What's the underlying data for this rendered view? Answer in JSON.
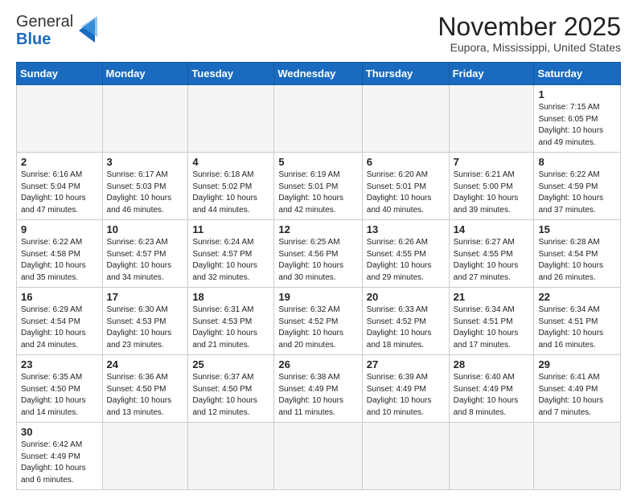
{
  "header": {
    "logo_general": "General",
    "logo_blue": "Blue",
    "month_title": "November 2025",
    "location": "Eupora, Mississippi, United States"
  },
  "days_of_week": [
    "Sunday",
    "Monday",
    "Tuesday",
    "Wednesday",
    "Thursday",
    "Friday",
    "Saturday"
  ],
  "weeks": [
    [
      {
        "day": "",
        "info": ""
      },
      {
        "day": "",
        "info": ""
      },
      {
        "day": "",
        "info": ""
      },
      {
        "day": "",
        "info": ""
      },
      {
        "day": "",
        "info": ""
      },
      {
        "day": "",
        "info": ""
      },
      {
        "day": "1",
        "info": "Sunrise: 7:15 AM\nSunset: 6:05 PM\nDaylight: 10 hours\nand 49 minutes."
      }
    ],
    [
      {
        "day": "2",
        "info": "Sunrise: 6:16 AM\nSunset: 5:04 PM\nDaylight: 10 hours\nand 47 minutes."
      },
      {
        "day": "3",
        "info": "Sunrise: 6:17 AM\nSunset: 5:03 PM\nDaylight: 10 hours\nand 46 minutes."
      },
      {
        "day": "4",
        "info": "Sunrise: 6:18 AM\nSunset: 5:02 PM\nDaylight: 10 hours\nand 44 minutes."
      },
      {
        "day": "5",
        "info": "Sunrise: 6:19 AM\nSunset: 5:01 PM\nDaylight: 10 hours\nand 42 minutes."
      },
      {
        "day": "6",
        "info": "Sunrise: 6:20 AM\nSunset: 5:01 PM\nDaylight: 10 hours\nand 40 minutes."
      },
      {
        "day": "7",
        "info": "Sunrise: 6:21 AM\nSunset: 5:00 PM\nDaylight: 10 hours\nand 39 minutes."
      },
      {
        "day": "8",
        "info": "Sunrise: 6:22 AM\nSunset: 4:59 PM\nDaylight: 10 hours\nand 37 minutes."
      }
    ],
    [
      {
        "day": "9",
        "info": "Sunrise: 6:22 AM\nSunset: 4:58 PM\nDaylight: 10 hours\nand 35 minutes."
      },
      {
        "day": "10",
        "info": "Sunrise: 6:23 AM\nSunset: 4:57 PM\nDaylight: 10 hours\nand 34 minutes."
      },
      {
        "day": "11",
        "info": "Sunrise: 6:24 AM\nSunset: 4:57 PM\nDaylight: 10 hours\nand 32 minutes."
      },
      {
        "day": "12",
        "info": "Sunrise: 6:25 AM\nSunset: 4:56 PM\nDaylight: 10 hours\nand 30 minutes."
      },
      {
        "day": "13",
        "info": "Sunrise: 6:26 AM\nSunset: 4:55 PM\nDaylight: 10 hours\nand 29 minutes."
      },
      {
        "day": "14",
        "info": "Sunrise: 6:27 AM\nSunset: 4:55 PM\nDaylight: 10 hours\nand 27 minutes."
      },
      {
        "day": "15",
        "info": "Sunrise: 6:28 AM\nSunset: 4:54 PM\nDaylight: 10 hours\nand 26 minutes."
      }
    ],
    [
      {
        "day": "16",
        "info": "Sunrise: 6:29 AM\nSunset: 4:54 PM\nDaylight: 10 hours\nand 24 minutes."
      },
      {
        "day": "17",
        "info": "Sunrise: 6:30 AM\nSunset: 4:53 PM\nDaylight: 10 hours\nand 23 minutes."
      },
      {
        "day": "18",
        "info": "Sunrise: 6:31 AM\nSunset: 4:53 PM\nDaylight: 10 hours\nand 21 minutes."
      },
      {
        "day": "19",
        "info": "Sunrise: 6:32 AM\nSunset: 4:52 PM\nDaylight: 10 hours\nand 20 minutes."
      },
      {
        "day": "20",
        "info": "Sunrise: 6:33 AM\nSunset: 4:52 PM\nDaylight: 10 hours\nand 18 minutes."
      },
      {
        "day": "21",
        "info": "Sunrise: 6:34 AM\nSunset: 4:51 PM\nDaylight: 10 hours\nand 17 minutes."
      },
      {
        "day": "22",
        "info": "Sunrise: 6:34 AM\nSunset: 4:51 PM\nDaylight: 10 hours\nand 16 minutes."
      }
    ],
    [
      {
        "day": "23",
        "info": "Sunrise: 6:35 AM\nSunset: 4:50 PM\nDaylight: 10 hours\nand 14 minutes."
      },
      {
        "day": "24",
        "info": "Sunrise: 6:36 AM\nSunset: 4:50 PM\nDaylight: 10 hours\nand 13 minutes."
      },
      {
        "day": "25",
        "info": "Sunrise: 6:37 AM\nSunset: 4:50 PM\nDaylight: 10 hours\nand 12 minutes."
      },
      {
        "day": "26",
        "info": "Sunrise: 6:38 AM\nSunset: 4:49 PM\nDaylight: 10 hours\nand 11 minutes."
      },
      {
        "day": "27",
        "info": "Sunrise: 6:39 AM\nSunset: 4:49 PM\nDaylight: 10 hours\nand 10 minutes."
      },
      {
        "day": "28",
        "info": "Sunrise: 6:40 AM\nSunset: 4:49 PM\nDaylight: 10 hours\nand 8 minutes."
      },
      {
        "day": "29",
        "info": "Sunrise: 6:41 AM\nSunset: 4:49 PM\nDaylight: 10 hours\nand 7 minutes."
      }
    ],
    [
      {
        "day": "30",
        "info": "Sunrise: 6:42 AM\nSunset: 4:49 PM\nDaylight: 10 hours\nand 6 minutes."
      },
      {
        "day": "",
        "info": ""
      },
      {
        "day": "",
        "info": ""
      },
      {
        "day": "",
        "info": ""
      },
      {
        "day": "",
        "info": ""
      },
      {
        "day": "",
        "info": ""
      },
      {
        "day": "",
        "info": ""
      }
    ]
  ]
}
